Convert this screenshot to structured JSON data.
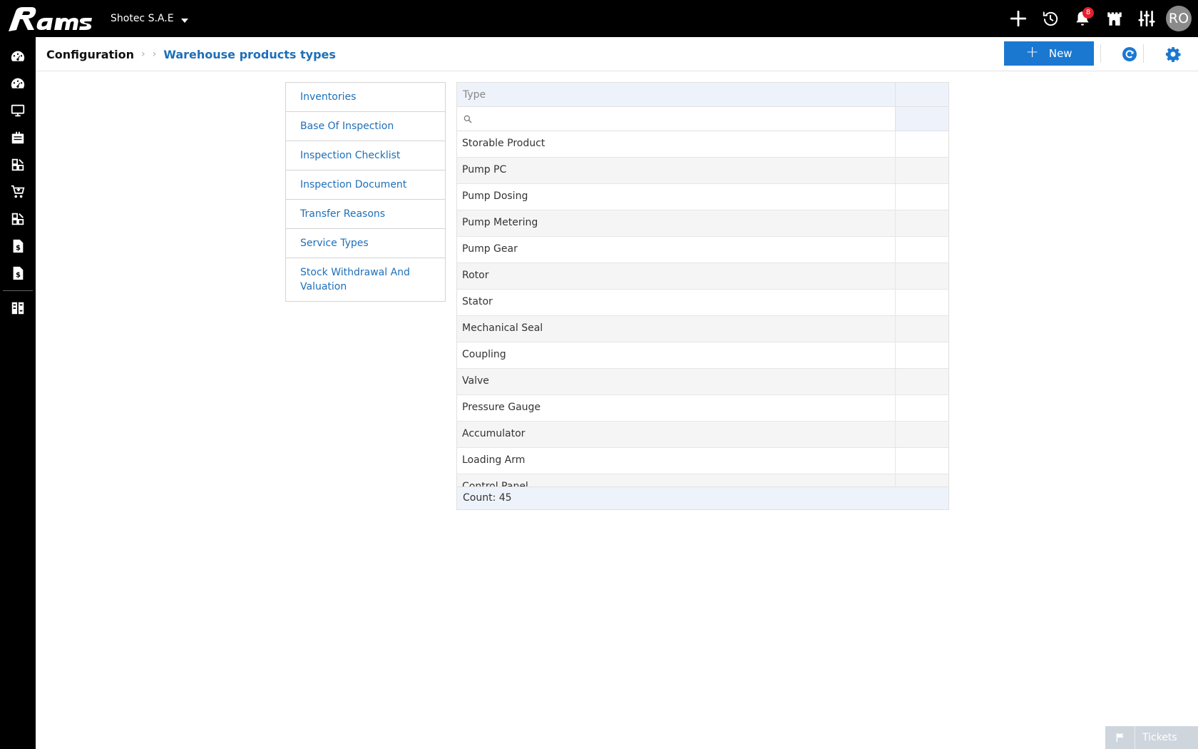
{
  "app": {
    "logo_text": "Rams",
    "company": "Shotec S.A.E"
  },
  "topbar": {
    "icons": [
      "plus-icon",
      "history-icon",
      "bell-icon",
      "castle-icon",
      "sliders-icon"
    ],
    "notification_count": "8",
    "avatar_initials": "RO"
  },
  "rail": {
    "icons": [
      "dashboard-icon",
      "dashboard-icon",
      "monitor-icon",
      "briefcase-icon",
      "modules-icon",
      "cart-icon",
      "modules-icon",
      "invoice-dollar-icon",
      "invoice-dollar-icon",
      "report-grid-icon"
    ]
  },
  "breadcrumb": {
    "root": "Configuration",
    "current": "Warehouse products types"
  },
  "header": {
    "new_label": "New"
  },
  "config_menu": {
    "items": [
      "Inventories",
      "Base Of Inspection",
      "Inspection Checklist",
      "Inspection Document",
      "Transfer Reasons",
      "Service Types",
      "Stock Withdrawal And Valuation"
    ]
  },
  "grid": {
    "column_type": "Type",
    "filter_value": "",
    "rows": [
      "Storable Product",
      "Pump PC",
      "Pump Dosing",
      "Pump Metering",
      "Pump Gear",
      "Rotor",
      "Stator",
      "Mechanical Seal",
      "Coupling",
      "Valve",
      "Pressure Gauge",
      "Accumulator",
      "Loading Arm",
      "Control Panel"
    ],
    "count_label": "Count: 45"
  },
  "tickets": {
    "label": "Tickets"
  },
  "colors": {
    "accent": "#1a78d1",
    "link": "#1e6fb8",
    "topbar": "#000000",
    "badge": "#e4202c"
  }
}
